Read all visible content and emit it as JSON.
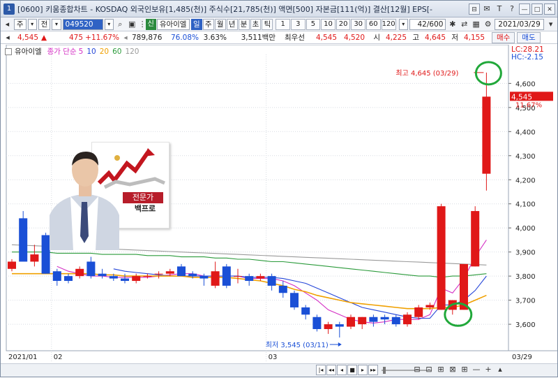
{
  "title": {
    "window_no": "1",
    "text": "[0600] 키움종합차트 - KOSDAQ 외국인보유[1,485(천)] 주식수[21,785(천)] 액면[500] 자본금[111(억)] 결산[12월] EPS[-",
    "buttons": [
      "⊟",
      "✉",
      "T",
      "?",
      "—",
      "□",
      "✕"
    ]
  },
  "toolbar": {
    "type": "주",
    "market": "전",
    "code": "049520",
    "badge": "신",
    "name": "유아이엘",
    "periods": [
      "일",
      "주",
      "월",
      "년",
      "분",
      "초",
      "틱"
    ],
    "active_period": "일",
    "nums": [
      "1",
      "3",
      "5",
      "10",
      "20",
      "30",
      "60",
      "120"
    ],
    "count": "42/600",
    "date": "2021/03/29"
  },
  "quote": {
    "price": "4,545",
    "change_arrow": "▲",
    "change": "475",
    "change_rate": "+11.67%",
    "volume": "789,876",
    "vol_ratio": "76.08%",
    "turnover": "3.63%",
    "amount": "3,511백만",
    "min_price_label": "최우선",
    "ask": "4,545",
    "bid": "4,520",
    "open_label": "시",
    "open": "4,225",
    "high_label": "고",
    "high": "4,645",
    "low_label": "저",
    "low": "4,155",
    "buy_label": "매수",
    "sell_label": "매도"
  },
  "legend": {
    "name": "유아이엘",
    "ma_label": "종가 단순",
    "ma": [
      {
        "period": "5",
        "color": "#d42fc4"
      },
      {
        "period": "10",
        "color": "#2445d8"
      },
      {
        "period": "20",
        "color": "#f0a000"
      },
      {
        "period": "60",
        "color": "#2a9a3a"
      },
      {
        "period": "120",
        "color": "#9a9a9a"
      }
    ]
  },
  "ad": {
    "tag1": "전문가",
    "tag2": "백프로"
  },
  "chart_data": {
    "type": "candlestick",
    "ylim": [
      3490,
      4720
    ],
    "y_ticks": [
      3600,
      3700,
      3800,
      3900,
      4000,
      4100,
      4200,
      4300,
      4400,
      4500,
      4600
    ],
    "y_tick_labels": [
      "3,600",
      "3,700",
      "3,800",
      "3,900",
      "4,000",
      "4,100",
      "4,200",
      "4,300",
      "4,400",
      "4,500",
      "4,600"
    ],
    "x_labels": [
      {
        "label": "2021/01",
        "index": 0
      },
      {
        "label": "02",
        "index": 4
      },
      {
        "label": "03",
        "index": 23
      },
      {
        "label": "03/29",
        "index": 42
      }
    ],
    "last_price_label": "4,545",
    "last_change_label": "11.67%",
    "lc_label": "LC:28.21",
    "hc_label": "HC:-2.15",
    "max_annotation": "최고 4,645 (03/29)",
    "min_annotation": "최저 3,545 (03/11)",
    "candles": [
      {
        "o": 3830,
        "h": 3870,
        "l": 3820,
        "c": 3860
      },
      {
        "o": 4040,
        "h": 4070,
        "l": 3870,
        "c": 3860
      },
      {
        "o": 3860,
        "h": 3930,
        "l": 3840,
        "c": 3890
      },
      {
        "o": 3970,
        "h": 3980,
        "l": 3810,
        "c": 3810
      },
      {
        "o": 3820,
        "h": 3830,
        "l": 3760,
        "c": 3780
      },
      {
        "o": 3800,
        "h": 3810,
        "l": 3770,
        "c": 3780
      },
      {
        "o": 3800,
        "h": 3840,
        "l": 3790,
        "c": 3830
      },
      {
        "o": 3860,
        "h": 3880,
        "l": 3790,
        "c": 3800
      },
      {
        "o": 3810,
        "h": 3830,
        "l": 3790,
        "c": 3800
      },
      {
        "o": 3800,
        "h": 3810,
        "l": 3780,
        "c": 3790
      },
      {
        "o": 3790,
        "h": 3810,
        "l": 3770,
        "c": 3780
      },
      {
        "o": 3780,
        "h": 3810,
        "l": 3770,
        "c": 3800
      },
      {
        "o": 3800,
        "h": 3810,
        "l": 3790,
        "c": 3800
      },
      {
        "o": 3810,
        "h": 3820,
        "l": 3790,
        "c": 3810
      },
      {
        "o": 3810,
        "h": 3830,
        "l": 3800,
        "c": 3820
      },
      {
        "o": 3840,
        "h": 3850,
        "l": 3800,
        "c": 3800
      },
      {
        "o": 3810,
        "h": 3820,
        "l": 3790,
        "c": 3800
      },
      {
        "o": 3800,
        "h": 3810,
        "l": 3760,
        "c": 3790
      },
      {
        "o": 3760,
        "h": 3860,
        "l": 3750,
        "c": 3820
      },
      {
        "o": 3840,
        "h": 3850,
        "l": 3750,
        "c": 3760
      },
      {
        "o": 3800,
        "h": 3830,
        "l": 3770,
        "c": 3800
      },
      {
        "o": 3800,
        "h": 3810,
        "l": 3760,
        "c": 3780
      },
      {
        "o": 3790,
        "h": 3810,
        "l": 3780,
        "c": 3800
      },
      {
        "o": 3800,
        "h": 3810,
        "l": 3740,
        "c": 3760
      },
      {
        "o": 3760,
        "h": 3780,
        "l": 3710,
        "c": 3730
      },
      {
        "o": 3730,
        "h": 3740,
        "l": 3660,
        "c": 3670
      },
      {
        "o": 3670,
        "h": 3680,
        "l": 3620,
        "c": 3640
      },
      {
        "o": 3630,
        "h": 3640,
        "l": 3570,
        "c": 3580
      },
      {
        "o": 3580,
        "h": 3610,
        "l": 3560,
        "c": 3600
      },
      {
        "o": 3600,
        "h": 3610,
        "l": 3545,
        "c": 3590
      },
      {
        "o": 3590,
        "h": 3640,
        "l": 3580,
        "c": 3630
      },
      {
        "o": 3600,
        "h": 3630,
        "l": 3580,
        "c": 3630
      },
      {
        "o": 3630,
        "h": 3640,
        "l": 3590,
        "c": 3610
      },
      {
        "o": 3630,
        "h": 3640,
        "l": 3600,
        "c": 3620
      },
      {
        "o": 3630,
        "h": 3640,
        "l": 3590,
        "c": 3600
      },
      {
        "o": 3600,
        "h": 3650,
        "l": 3590,
        "c": 3640
      },
      {
        "o": 3630,
        "h": 3680,
        "l": 3620,
        "c": 3670
      },
      {
        "o": 3670,
        "h": 3690,
        "l": 3660,
        "c": 3680
      },
      {
        "o": 3660,
        "h": 4100,
        "l": 3660,
        "c": 4090
      },
      {
        "o": 3660,
        "h": 3700,
        "l": 3640,
        "c": 3700
      },
      {
        "o": 3660,
        "h": 3850,
        "l": 3660,
        "c": 3850
      },
      {
        "o": 3840,
        "h": 4090,
        "l": 3840,
        "c": 4070
      },
      {
        "o": 4225,
        "h": 4645,
        "l": 4155,
        "c": 4545
      }
    ],
    "ma": [
      {
        "period": "5",
        "values": [
          null,
          null,
          null,
          null,
          3840,
          3820,
          3810,
          3800,
          3800,
          3795,
          3795,
          3795,
          3795,
          3800,
          3805,
          3810,
          3810,
          3800,
          3800,
          3800,
          3800,
          3790,
          3790,
          3790,
          3780,
          3760,
          3730,
          3700,
          3660,
          3640,
          3620,
          3610,
          3605,
          3610,
          3620,
          3620,
          3620,
          3640,
          3750,
          3730,
          3790,
          3880,
          3950
        ]
      },
      {
        "period": "10",
        "values": [
          null,
          null,
          null,
          null,
          null,
          null,
          null,
          null,
          null,
          3830,
          3820,
          3815,
          3810,
          3805,
          3800,
          3800,
          3800,
          3800,
          3800,
          3800,
          3800,
          3795,
          3795,
          3795,
          3790,
          3780,
          3770,
          3750,
          3730,
          3710,
          3690,
          3670,
          3660,
          3650,
          3640,
          3630,
          3625,
          3625,
          3680,
          3680,
          3700,
          3740,
          3800
        ]
      },
      {
        "period": "20",
        "values": [
          3810,
          3810,
          3810,
          3810,
          3810,
          3810,
          3810,
          3810,
          3805,
          3805,
          3800,
          3800,
          3800,
          3800,
          3800,
          3800,
          3795,
          3795,
          3795,
          3795,
          3790,
          3785,
          3780,
          3770,
          3760,
          3745,
          3735,
          3720,
          3710,
          3700,
          3690,
          3685,
          3680,
          3675,
          3670,
          3665,
          3665,
          3665,
          3670,
          3670,
          3680,
          3700,
          3720
        ]
      },
      {
        "period": "60",
        "values": [
          3900,
          3900,
          3900,
          3900,
          3895,
          3895,
          3895,
          3895,
          3890,
          3890,
          3890,
          3890,
          3885,
          3885,
          3885,
          3880,
          3880,
          3880,
          3875,
          3875,
          3870,
          3870,
          3865,
          3860,
          3860,
          3855,
          3850,
          3845,
          3840,
          3835,
          3830,
          3825,
          3820,
          3815,
          3810,
          3805,
          3800,
          3800,
          3795,
          3800,
          3800,
          3805,
          3810
        ]
      },
      {
        "period": "120",
        "values": [
          3930,
          3928,
          3926,
          3924,
          3922,
          3920,
          3918,
          3916,
          3914,
          3912,
          3910,
          3908,
          3906,
          3904,
          3902,
          3900,
          3898,
          3896,
          3894,
          3892,
          3890,
          3888,
          3886,
          3884,
          3882,
          3880,
          3878,
          3876,
          3874,
          3872,
          3870,
          3868,
          3866,
          3864,
          3862,
          3860,
          3858,
          3856,
          3854,
          3852,
          3850,
          3848,
          3846
        ]
      }
    ]
  }
}
